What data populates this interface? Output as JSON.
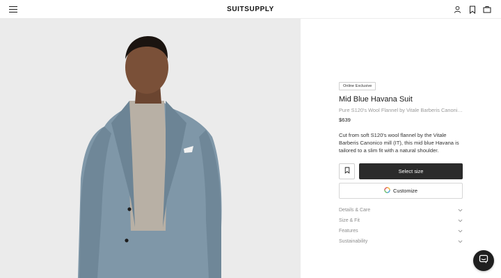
{
  "header": {
    "logo": "SUITSUPPLY",
    "icons": [
      "menu-icon",
      "account-icon",
      "bookmark-icon",
      "bag-icon"
    ]
  },
  "product": {
    "badge": "Online Exclusive",
    "title": "Mid Blue Havana Suit",
    "subtitle": "Pure S120's Wool Flannel by Vitale Barberis Canonico",
    "price": "$639",
    "description": "Cut from soft S120's wool flannel by the Vitale Barberis Canonico mill (IT), this mid blue Havana is tailored to a slim fit with a natural shoulder.",
    "select_size_label": "Select size",
    "customize_label": "Customize",
    "accordion": [
      {
        "label": "Details & Care"
      },
      {
        "label": "Size & Fit"
      },
      {
        "label": "Features"
      },
      {
        "label": "Sustainability"
      }
    ]
  },
  "colors": {
    "primary_button": "#2b2b2b",
    "photo_background": "#ebebeb",
    "suit": "#7f97a8"
  }
}
